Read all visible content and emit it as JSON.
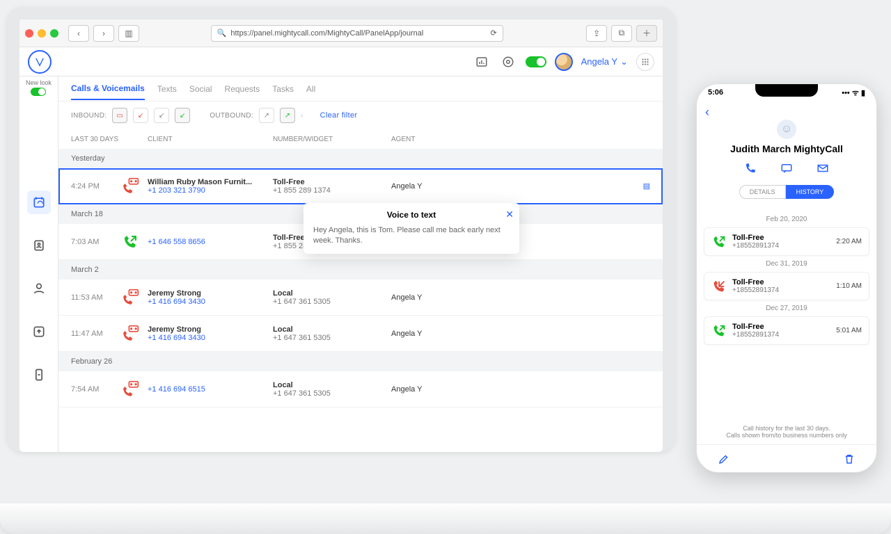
{
  "browser": {
    "url": "https://panel.mightycall.com/MightyCall/PanelApp/journal"
  },
  "app": {
    "user_name": "Angela Y",
    "new_look": "New look"
  },
  "tabs": [
    "Calls & Voicemails",
    "Texts",
    "Social",
    "Requests",
    "Tasks",
    "All"
  ],
  "filters": {
    "inbound": "INBOUND:",
    "outbound": "OUTBOUND:",
    "clear": "Clear filter"
  },
  "columns": {
    "time": "LAST 30 DAYS",
    "client": "CLIENT",
    "number": "NUMBER/WIDGET",
    "agent": "AGENT"
  },
  "groups": [
    {
      "label": "Yesterday",
      "rows": [
        {
          "time": "4:24 PM",
          "icon": "voicemail-in",
          "color": "red",
          "name": "William Ruby Mason Furnit...",
          "link": "+1 203 321 3790",
          "num_lbl": "Toll-Free",
          "num": "+1 855 289 1374",
          "agent": "Angela Y",
          "selected": true
        }
      ]
    },
    {
      "label": "March 18",
      "rows": [
        {
          "time": "7:03 AM",
          "icon": "out",
          "color": "green",
          "name": "",
          "link": "+1 646 558 8656",
          "num_lbl": "Toll-Free",
          "num": "+1 855 289 ...",
          "agent": ""
        }
      ]
    },
    {
      "label": "March 2",
      "rows": [
        {
          "time": "11:53 AM",
          "icon": "voicemail-in",
          "color": "red",
          "name": "Jeremy Strong",
          "link": "+1 416 694 3430",
          "num_lbl": "Local",
          "num": "+1 647 361 5305",
          "agent": "Angela Y"
        },
        {
          "time": "11:47 AM",
          "icon": "voicemail-in",
          "color": "red",
          "name": "Jeremy Strong",
          "link": "+1 416 694 3430",
          "num_lbl": "Local",
          "num": "+1 647 361 5305",
          "agent": "Angela Y"
        }
      ]
    },
    {
      "label": "February 26",
      "rows": [
        {
          "time": "7:54 AM",
          "icon": "voicemail-in",
          "color": "red",
          "name": "",
          "link": "+1 416 694 6515",
          "num_lbl": "Local",
          "num": "+1 647 361 5305",
          "agent": "Angela Y"
        }
      ]
    }
  ],
  "popup": {
    "title": "Voice to text",
    "body": "Hey Angela, this is Tom. Please call me back early next week. Thanks."
  },
  "phone": {
    "time": "5:06",
    "contact_name": "Judith March MightyCall",
    "seg": {
      "details": "DETAILS",
      "history": "HISTORY"
    },
    "items": [
      {
        "date": "Feb 20, 2020",
        "icon": "out",
        "color": "green",
        "title": "Toll-Free",
        "num": "+18552891374",
        "time": "2:20 AM"
      },
      {
        "date": "Dec 31, 2019",
        "icon": "missed",
        "color": "red",
        "title": "Toll-Free",
        "num": "+18552891374",
        "time": "1:10 AM"
      },
      {
        "date": "Dec 27, 2019",
        "icon": "out",
        "color": "green",
        "title": "Toll-Free",
        "num": "+18552891374",
        "time": "5:01 AM"
      }
    ],
    "foot1": "Call history for the last 30 days.",
    "foot2": "Calls shown from/to business numbers only"
  }
}
